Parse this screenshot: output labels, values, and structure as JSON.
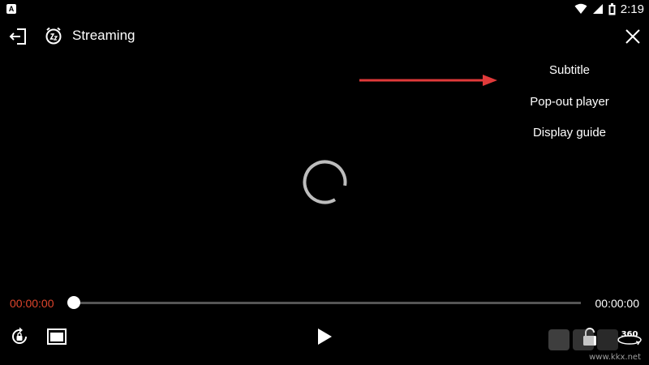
{
  "status_bar": {
    "app_badge": "A",
    "time": "2:19",
    "icons": [
      "wifi-icon",
      "cellular-icon",
      "battery-icon"
    ]
  },
  "top_bar": {
    "title": "Streaming",
    "left_icons": [
      "exit-icon",
      "sleep-timer-icon"
    ],
    "right_icon": "close-icon"
  },
  "menu": {
    "items": [
      "Subtitle",
      "Pop-out player",
      "Display guide"
    ]
  },
  "player": {
    "elapsed": "00:00:00",
    "total": "00:00:00",
    "progress": 0,
    "state": "loading"
  },
  "controls": {
    "left": [
      "rotate-lock-icon",
      "aspect-ratio-icon"
    ],
    "center": "play-icon",
    "right": [
      "screen-lock-icon",
      "360-view-icon"
    ],
    "badge_360": "360"
  },
  "watermark": {
    "text": "www.kkx.net"
  },
  "colors": {
    "background": "#000000",
    "accent_time": "#e0452c",
    "arrow": "#e03a3a",
    "track": "#555555"
  }
}
